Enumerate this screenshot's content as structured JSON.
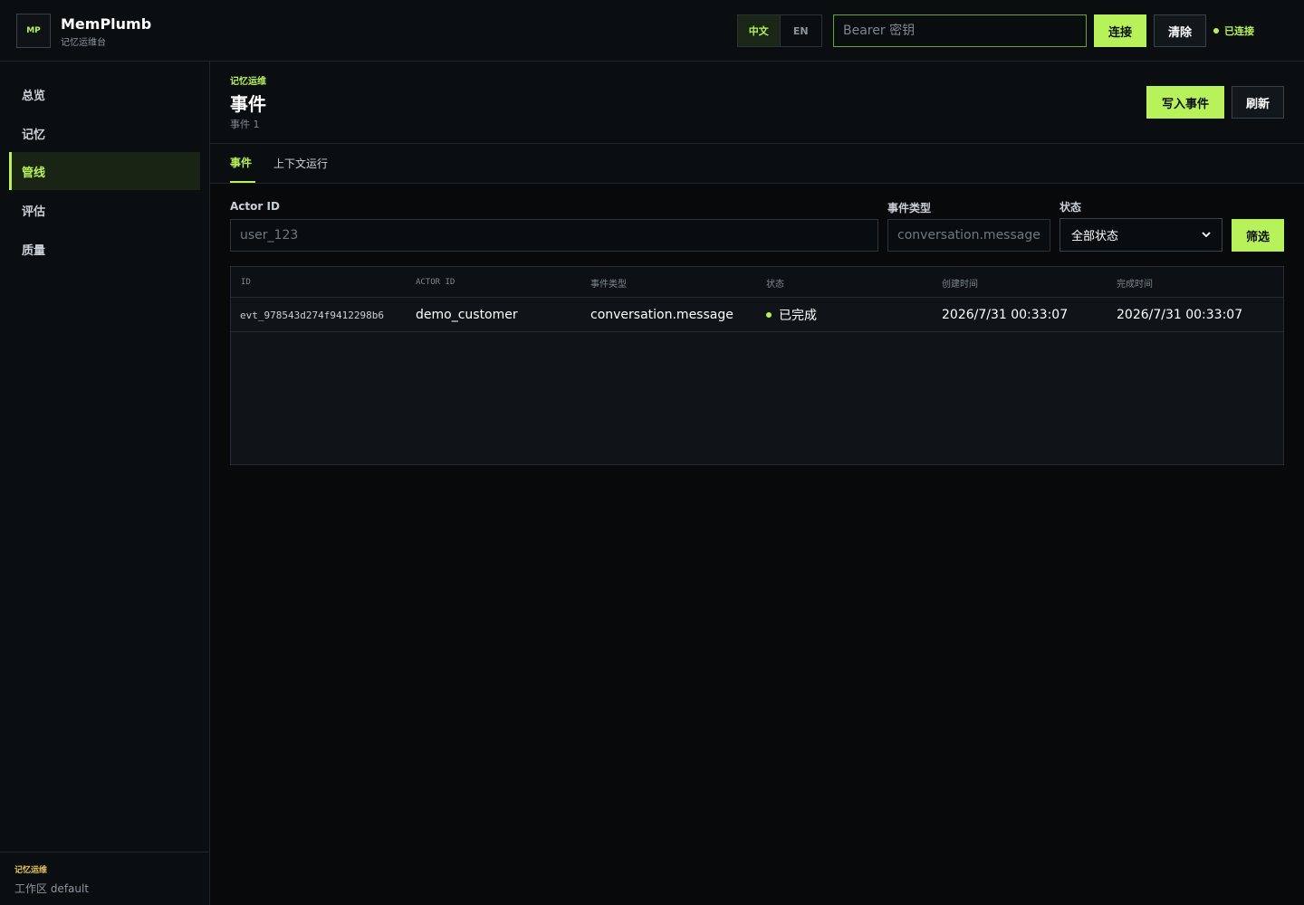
{
  "app": {
    "logo_text": "MP",
    "name": "MemPlumb",
    "subtitle": "记忆运维台"
  },
  "header": {
    "lang_zh": "中文",
    "lang_en": "EN",
    "token_placeholder": "Bearer 密钥",
    "connect_label": "连接",
    "clear_label": "清除",
    "status_text": "已连接"
  },
  "sidebar": {
    "items": [
      {
        "label": "总览"
      },
      {
        "label": "记忆"
      },
      {
        "label": "管线"
      },
      {
        "label": "评估"
      },
      {
        "label": "质量"
      }
    ],
    "active_index": 2,
    "footer_label": "记忆运维",
    "workspace": "工作区 default"
  },
  "page": {
    "eyebrow": "记忆运维",
    "title": "事件",
    "count": "事件 1",
    "write_event_label": "写入事件",
    "refresh_label": "刷新"
  },
  "tabs": [
    {
      "label": "事件"
    },
    {
      "label": "上下文运行"
    }
  ],
  "filters": {
    "actor_label": "Actor ID",
    "actor_placeholder": "user_123",
    "type_label": "事件类型",
    "type_placeholder": "conversation.message",
    "status_label": "状态",
    "status_value": "全部状态",
    "filter_button": "筛选"
  },
  "table": {
    "columns": [
      "ID",
      "ACTOR ID",
      "事件类型",
      "状态",
      "创建时间",
      "完成时间"
    ],
    "rows": [
      {
        "id": "evt_978543d274f9412298b6",
        "actor_id": "demo_customer",
        "event_type": "conversation.message",
        "status": "已完成",
        "created_at": "2026/7/31 00:33:07",
        "completed_at": "2026/7/31 00:33:07"
      }
    ]
  },
  "colors": {
    "accent": "#b7f25a",
    "background": "#07090b",
    "panel": "#0b0e11",
    "warning_label": "#e7c25c"
  }
}
